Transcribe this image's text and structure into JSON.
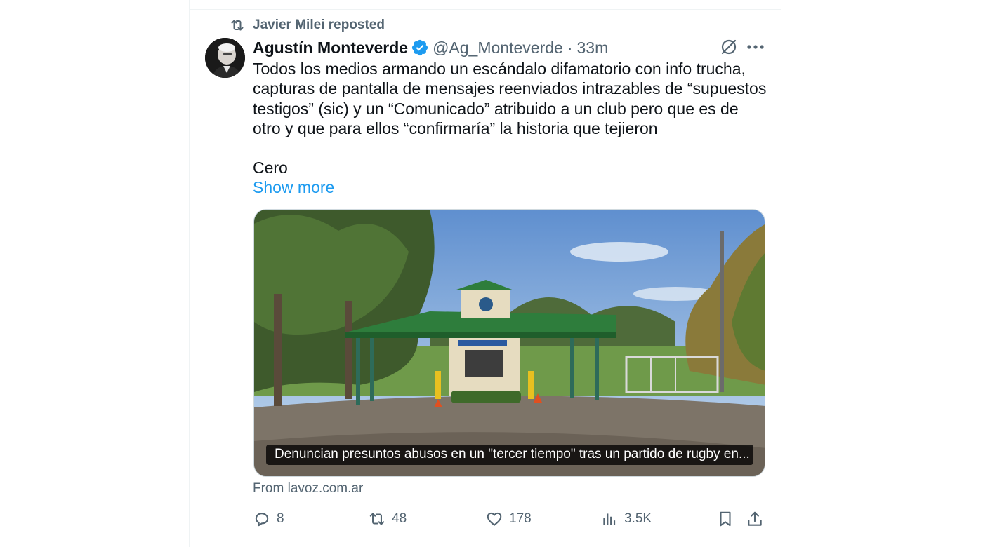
{
  "social_context": {
    "text": "Javier Milei reposted",
    "icon": "repost-icon"
  },
  "author": {
    "display_name": "Agustín Monteverde",
    "handle": "@Ag_Monteverde",
    "separator": "·",
    "time": "33m",
    "verified": true,
    "verified_color": "#1d9bf0"
  },
  "tweet": {
    "text": "Todos los medios armando un escándalo difamatorio con info trucha, capturas de pantalla de mensajes reenviados intrazables de “supuestos testigos” (sic) y un “Comunicado” atribuido a un club pero que es de otro y que para ellos “confirmaría” la historia que tejieron\n\nCero",
    "show_more": "Show more"
  },
  "link_card": {
    "caption": "Denuncian presuntos abusos en un \"tercer tiempo\" tras un partido de rugby en...",
    "source": "From lavoz.com.ar"
  },
  "actions": {
    "replies": "8",
    "reposts": "48",
    "likes": "178",
    "views": "3.5K"
  },
  "colors": {
    "accent": "#1d9bf0",
    "text_primary": "#0f1419",
    "text_secondary": "#536471"
  }
}
